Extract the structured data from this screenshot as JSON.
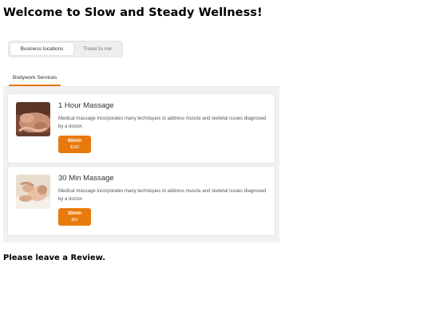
{
  "page": {
    "title": "Welcome to Slow and Steady Wellness!",
    "review_heading": "Please leave a Review."
  },
  "location_toggle": {
    "options": [
      {
        "label": "Business locations",
        "selected": true
      },
      {
        "label": "Travel to me",
        "selected": false
      }
    ]
  },
  "tabs": [
    {
      "label": "Bodywork Services",
      "active": true
    }
  ],
  "services": [
    {
      "title": "1 Hour Massage",
      "description": "Medical massage incorporates many techniques to address muscle and skeletal issues diagnosed by a doctor.",
      "duration": "60min",
      "price": "$100",
      "image": "massage-back-photo"
    },
    {
      "title": "30 Min Massage",
      "description": "Medical massage incorporates many techniques to address muscle and skeletal issues diagnosed by a doctor.",
      "duration": "30min",
      "price": "$60",
      "image": "massage-face-photo"
    }
  ],
  "colors": {
    "accent": "#e8790c",
    "panel_background": "#f1f1f1",
    "card_background": "#ffffff"
  }
}
